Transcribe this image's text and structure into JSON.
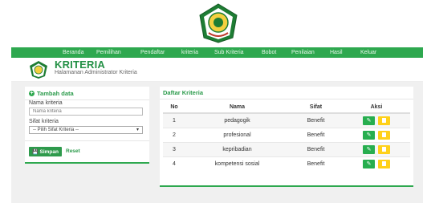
{
  "nav": {
    "items": [
      "Beranda",
      "Pemilihan",
      "Pendaftar",
      "kriteria",
      "Sub Kriteria",
      "Bobot",
      "Penilaian",
      "Hasil",
      "Keluar"
    ]
  },
  "header": {
    "title": "KRITERIA",
    "subtitle": "Halamanan Administrator Kriteria"
  },
  "form": {
    "title": "Tambah data",
    "nama_label": "Nama kriteria",
    "nama_placeholder": "Nama kriteria",
    "sifat_label": "Sifat kriteria",
    "sifat_selected": "-- Pilih Sifat Kriteria --",
    "save_label": "Simpan",
    "reset_label": "Reset"
  },
  "list": {
    "title": "Daftar Kriteria",
    "columns": [
      "No",
      "Nama",
      "Sifat",
      "Aksi"
    ],
    "rows": [
      {
        "no": "1",
        "nama": "pedagogik",
        "sifat": "Benefit"
      },
      {
        "no": "2",
        "nama": "profesional",
        "sifat": "Benefit"
      },
      {
        "no": "3",
        "nama": "kepribadian",
        "sifat": "Benefit"
      },
      {
        "no": "4",
        "nama": "kompetensi sosial",
        "sifat": "Benefit"
      }
    ]
  },
  "colors": {
    "accent": "#2ea84f",
    "edit_button": "#27ae4f",
    "delete_button": "#ffd11a"
  },
  "icons": [
    "emblem-logo",
    "plus-circle-icon",
    "save-icon",
    "pencil-icon",
    "trash-icon",
    "chevron-down-icon"
  ]
}
